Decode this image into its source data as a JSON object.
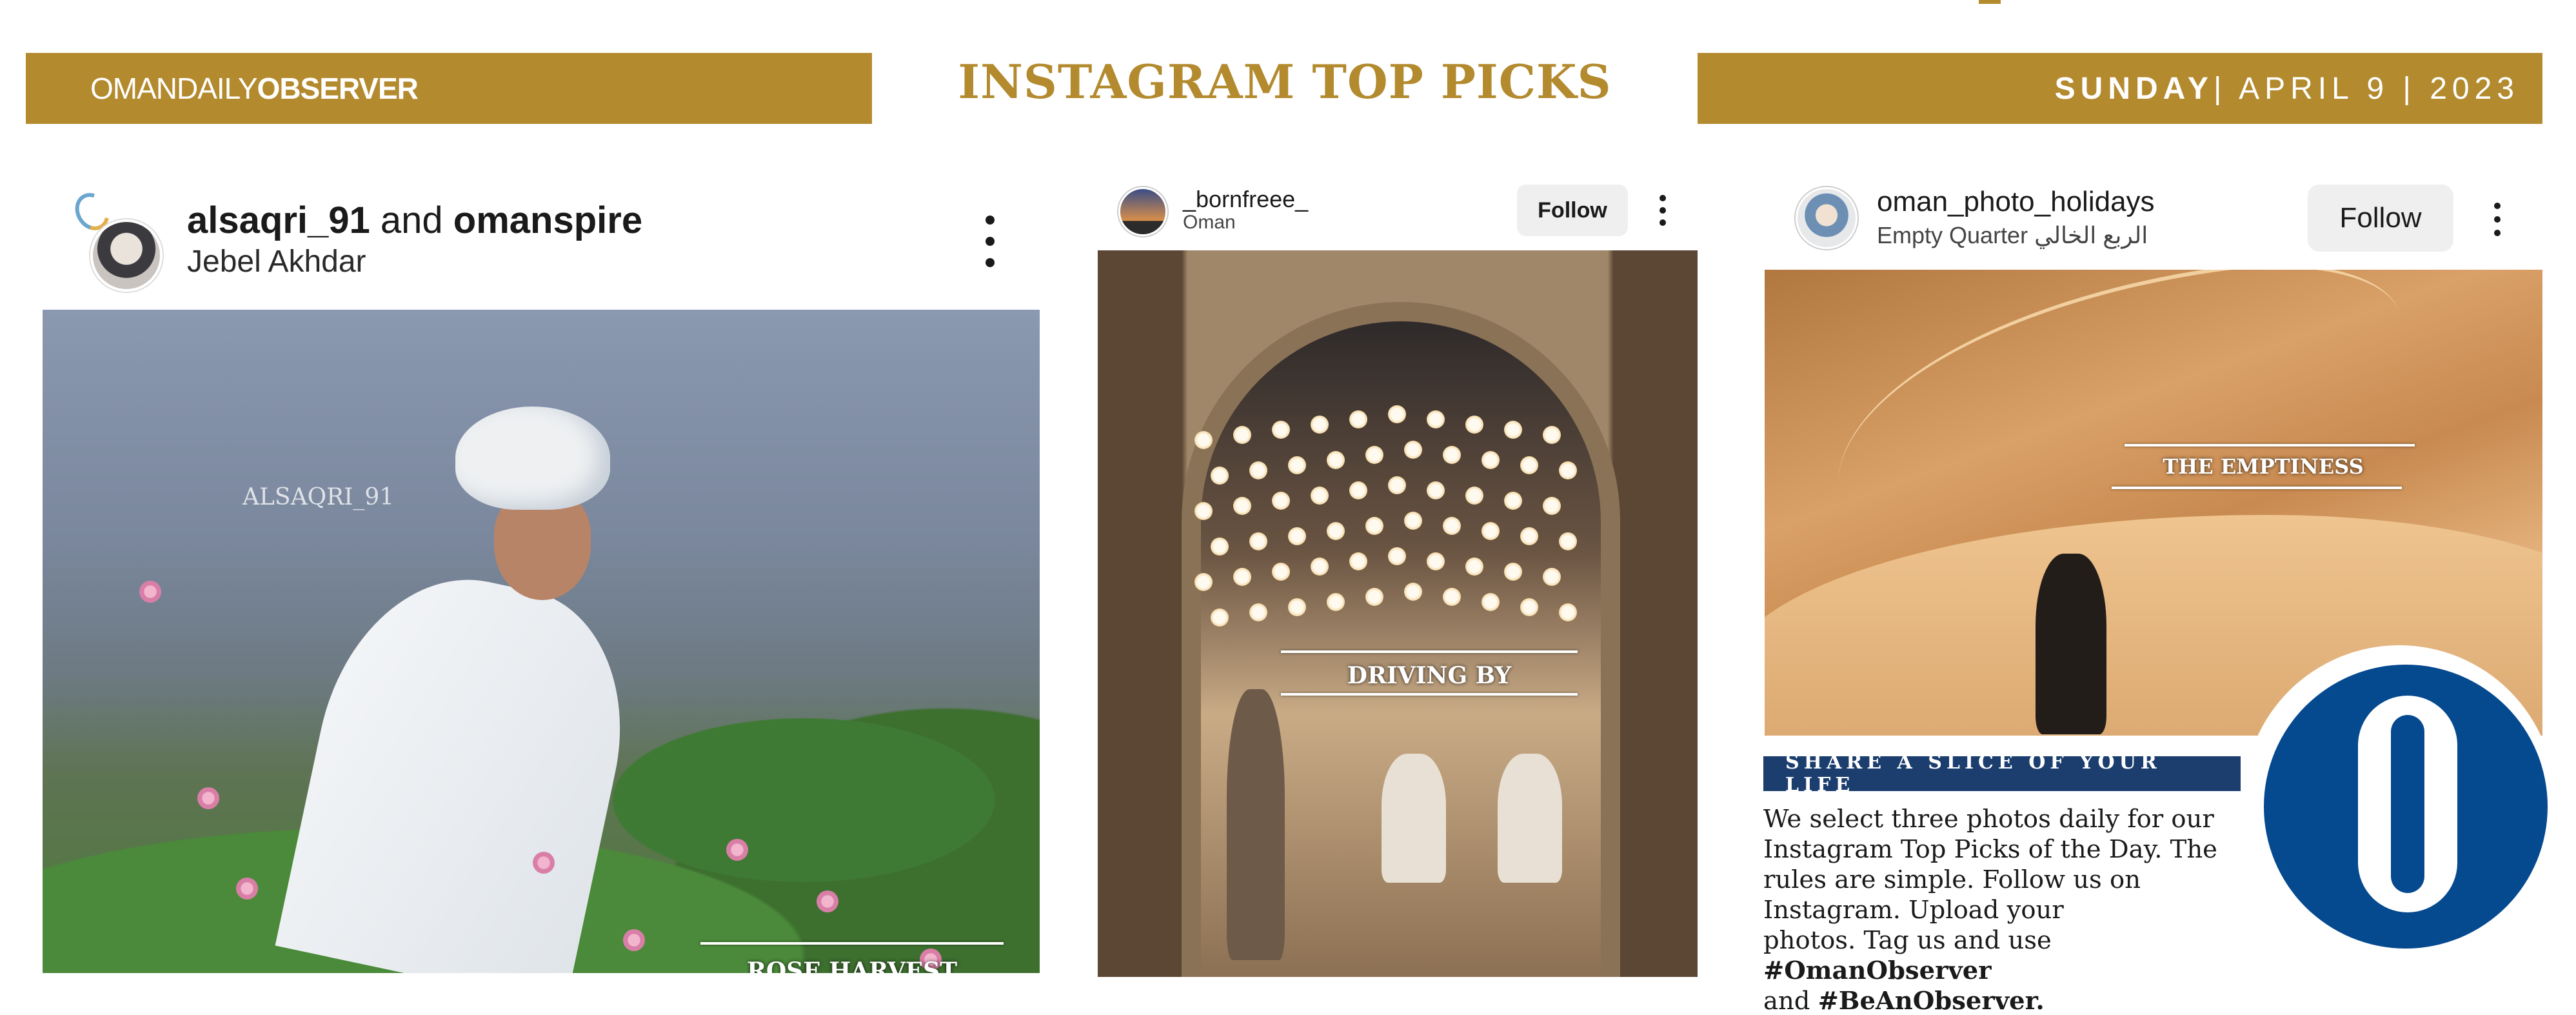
{
  "masthead": {
    "brand_light": "OMANDAILY",
    "brand_bold": "OBSERVER",
    "title": "INSTAGRAM TOP PICKS",
    "date_day": "SUNDAY",
    "date_rest": " | APRIL 9 | 2023"
  },
  "posts": [
    {
      "username": "alsaqri_91",
      "joiner": " and ",
      "collaborator": "omanspire",
      "location": "Jebel Akhdar",
      "watermark": "ALSAQRI_91",
      "caption": "ROSE HARVEST"
    },
    {
      "username": "_bornfreee_",
      "location": "Oman",
      "follow_label": "Follow",
      "caption": "DRIVING BY"
    },
    {
      "username": "oman_photo_holidays",
      "location": "Empty Quarter  الربع الخالي",
      "follow_label": "Follow",
      "caption": "THE EMPTINESS"
    }
  ],
  "share": {
    "banner": "SHARE A SLICE OF YOUR LIFE",
    "line1": "We select three photos daily for our",
    "line2": "Instagram Top Picks of the Day. The",
    "line3": "rules are simple. Follow us on",
    "line4": "Instagram. Upload your",
    "line5_pre": "photos. Tag us and use ",
    "tag1": "#OmanObserver",
    "line6_pre": "and ",
    "tag2": "#BeAnObserver."
  },
  "colors": {
    "gold": "#b38a2e",
    "navy_banner": "#1b3e6f",
    "logo_blue": "#05498f"
  },
  "icons": [
    "more-vertical-icon",
    "observer-o-logo"
  ]
}
